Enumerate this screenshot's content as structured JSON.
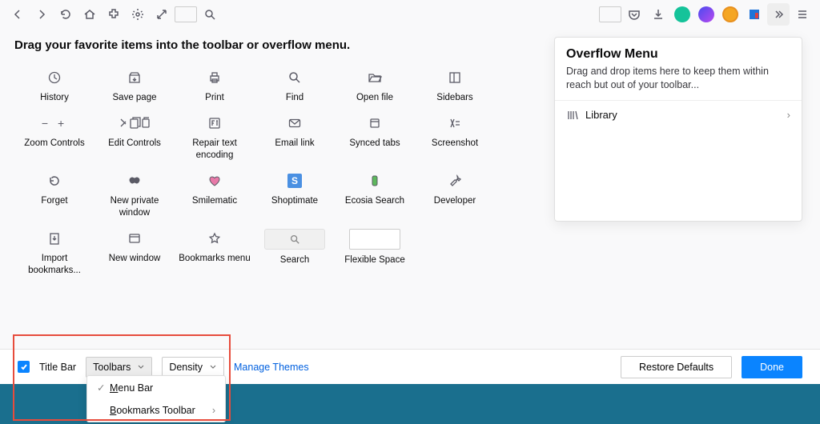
{
  "heading": "Drag your favorite items into the toolbar or overflow menu.",
  "grid": [
    {
      "id": "history",
      "label": "History"
    },
    {
      "id": "save-page",
      "label": "Save page"
    },
    {
      "id": "print",
      "label": "Print"
    },
    {
      "id": "find",
      "label": "Find"
    },
    {
      "id": "open-file",
      "label": "Open file"
    },
    {
      "id": "sidebars",
      "label": "Sidebars"
    },
    {
      "id": "zoom",
      "label": "Zoom Controls"
    },
    {
      "id": "edit",
      "label": "Edit Controls"
    },
    {
      "id": "repair",
      "label": "Repair text encoding"
    },
    {
      "id": "email",
      "label": "Email link"
    },
    {
      "id": "synced",
      "label": "Synced tabs"
    },
    {
      "id": "screenshot",
      "label": "Screenshot"
    },
    {
      "id": "forget",
      "label": "Forget"
    },
    {
      "id": "private",
      "label": "New private window"
    },
    {
      "id": "smilematic",
      "label": "Smilematic"
    },
    {
      "id": "shoptimate",
      "label": "Shoptimate"
    },
    {
      "id": "ecosia",
      "label": "Ecosia Search"
    },
    {
      "id": "developer",
      "label": "Developer"
    },
    {
      "id": "import",
      "label": "Import bookmarks..."
    },
    {
      "id": "new-window",
      "label": "New window"
    },
    {
      "id": "bookmarks-menu",
      "label": "Bookmarks menu"
    },
    {
      "id": "search",
      "label": "Search"
    },
    {
      "id": "flexible",
      "label": "Flexible Space"
    }
  ],
  "overflow": {
    "title": "Overflow Menu",
    "desc": "Drag and drop items here to keep them within reach but out of your toolbar...",
    "item_label": "Library"
  },
  "bottom": {
    "title_bar": "Title Bar",
    "toolbars": "Toolbars",
    "density": "Density",
    "themes": "Manage Themes",
    "restore": "Restore Defaults",
    "done": "Done"
  },
  "dropdown": {
    "menu_bar_pre": "M",
    "menu_bar_rest": "enu Bar",
    "bookmarks_pre": "B",
    "bookmarks_rest": "ookmarks Toolbar"
  }
}
